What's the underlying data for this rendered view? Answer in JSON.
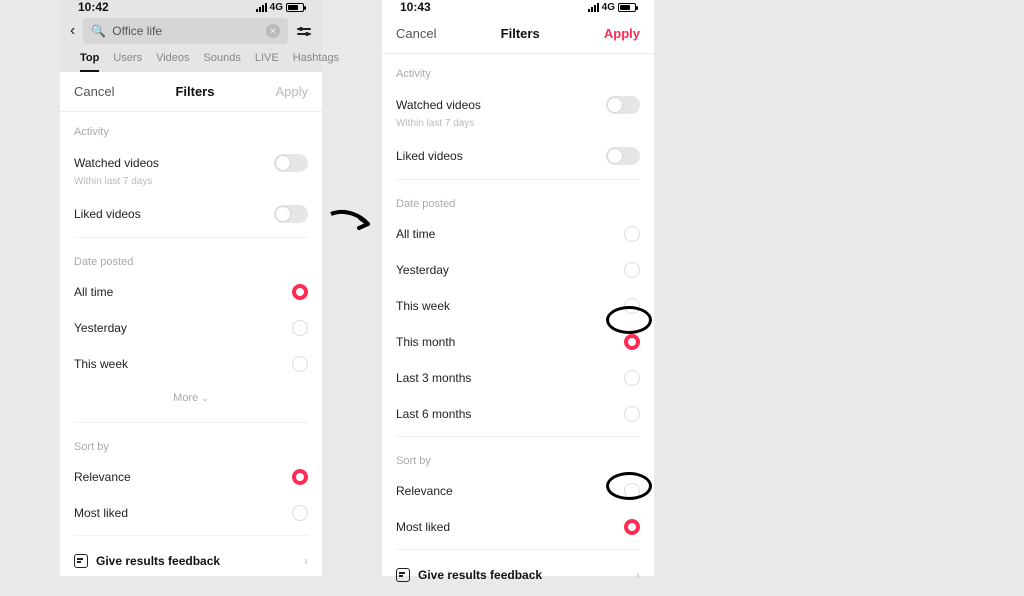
{
  "left": {
    "time": "10:42",
    "net": "4G",
    "search_text": "Office life",
    "tabs": [
      "Top",
      "Users",
      "Videos",
      "Sounds",
      "LIVE",
      "Hashtags"
    ],
    "active_tab": 0,
    "header": {
      "cancel": "Cancel",
      "title": "Filters",
      "apply": "Apply",
      "apply_active": false
    },
    "activity": {
      "label": "Activity",
      "watched": {
        "label": "Watched videos",
        "sub": "Within last 7 days",
        "on": false
      },
      "liked": {
        "label": "Liked videos",
        "on": false
      }
    },
    "date_posted": {
      "label": "Date posted",
      "options": [
        {
          "label": "All time",
          "selected": true
        },
        {
          "label": "Yesterday",
          "selected": false
        },
        {
          "label": "This week",
          "selected": false
        }
      ],
      "more": "More"
    },
    "sort_by": {
      "label": "Sort by",
      "options": [
        {
          "label": "Relevance",
          "selected": true
        },
        {
          "label": "Most liked",
          "selected": false
        }
      ]
    },
    "feedback": "Give results feedback"
  },
  "right": {
    "time": "10:43",
    "net": "4G",
    "header": {
      "cancel": "Cancel",
      "title": "Filters",
      "apply": "Apply",
      "apply_active": true
    },
    "activity": {
      "label": "Activity",
      "watched": {
        "label": "Watched videos",
        "sub": "Within last 7 days",
        "on": false
      },
      "liked": {
        "label": "Liked videos",
        "on": false
      }
    },
    "date_posted": {
      "label": "Date posted",
      "options": [
        {
          "label": "All time",
          "selected": false
        },
        {
          "label": "Yesterday",
          "selected": false
        },
        {
          "label": "This week",
          "selected": false
        },
        {
          "label": "This month",
          "selected": true
        },
        {
          "label": "Last 3 months",
          "selected": false
        },
        {
          "label": "Last 6 months",
          "selected": false
        }
      ]
    },
    "sort_by": {
      "label": "Sort by",
      "options": [
        {
          "label": "Relevance",
          "selected": false
        },
        {
          "label": "Most liked",
          "selected": true
        }
      ]
    },
    "feedback": "Give results feedback"
  }
}
